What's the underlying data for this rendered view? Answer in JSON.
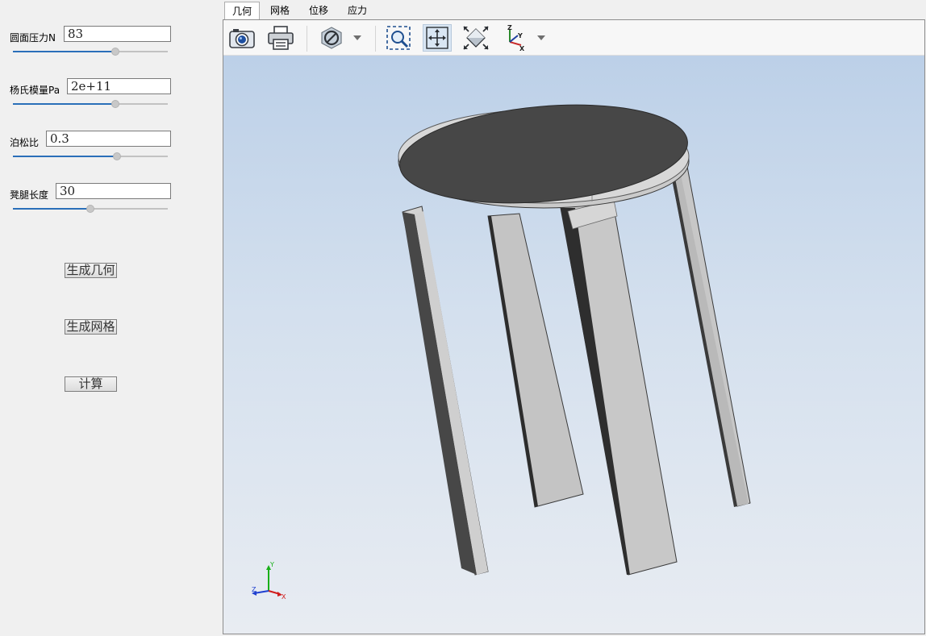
{
  "params": [
    {
      "label": "圆面压力N",
      "value": "83",
      "slider_percent": 66
    },
    {
      "label": "杨氏模量Pa",
      "value": "2e+11",
      "slider_percent": 66
    },
    {
      "label": "泊松比",
      "value": "0.3",
      "slider_percent": 67
    },
    {
      "label": "凳腿长度",
      "value": "30",
      "slider_percent": 50
    }
  ],
  "buttons": {
    "generate_geometry": "生成几何",
    "generate_mesh": "生成网格",
    "compute": "计算"
  },
  "tabs": [
    {
      "label": "几何",
      "active": true
    },
    {
      "label": "网格",
      "active": false
    },
    {
      "label": "位移",
      "active": false
    },
    {
      "label": "应力",
      "active": false
    }
  ],
  "toolbar": {
    "icons": [
      "camera-icon",
      "print-icon",
      "no-section-icon",
      "zoom-window-icon",
      "pan-icon",
      "fit-all-icon",
      "view-axes-icon"
    ],
    "axes_labels": {
      "x": "X",
      "y": "Y",
      "z": "Z"
    }
  },
  "triad": {
    "x": "X",
    "y": "Y",
    "z": "Z"
  },
  "colors": {
    "accent": "#2a6fb9",
    "model_dark": "#474747",
    "model_light": "#c8c8c8",
    "background_top": "#bcd0e8",
    "background_bottom": "#e8ecf2"
  }
}
